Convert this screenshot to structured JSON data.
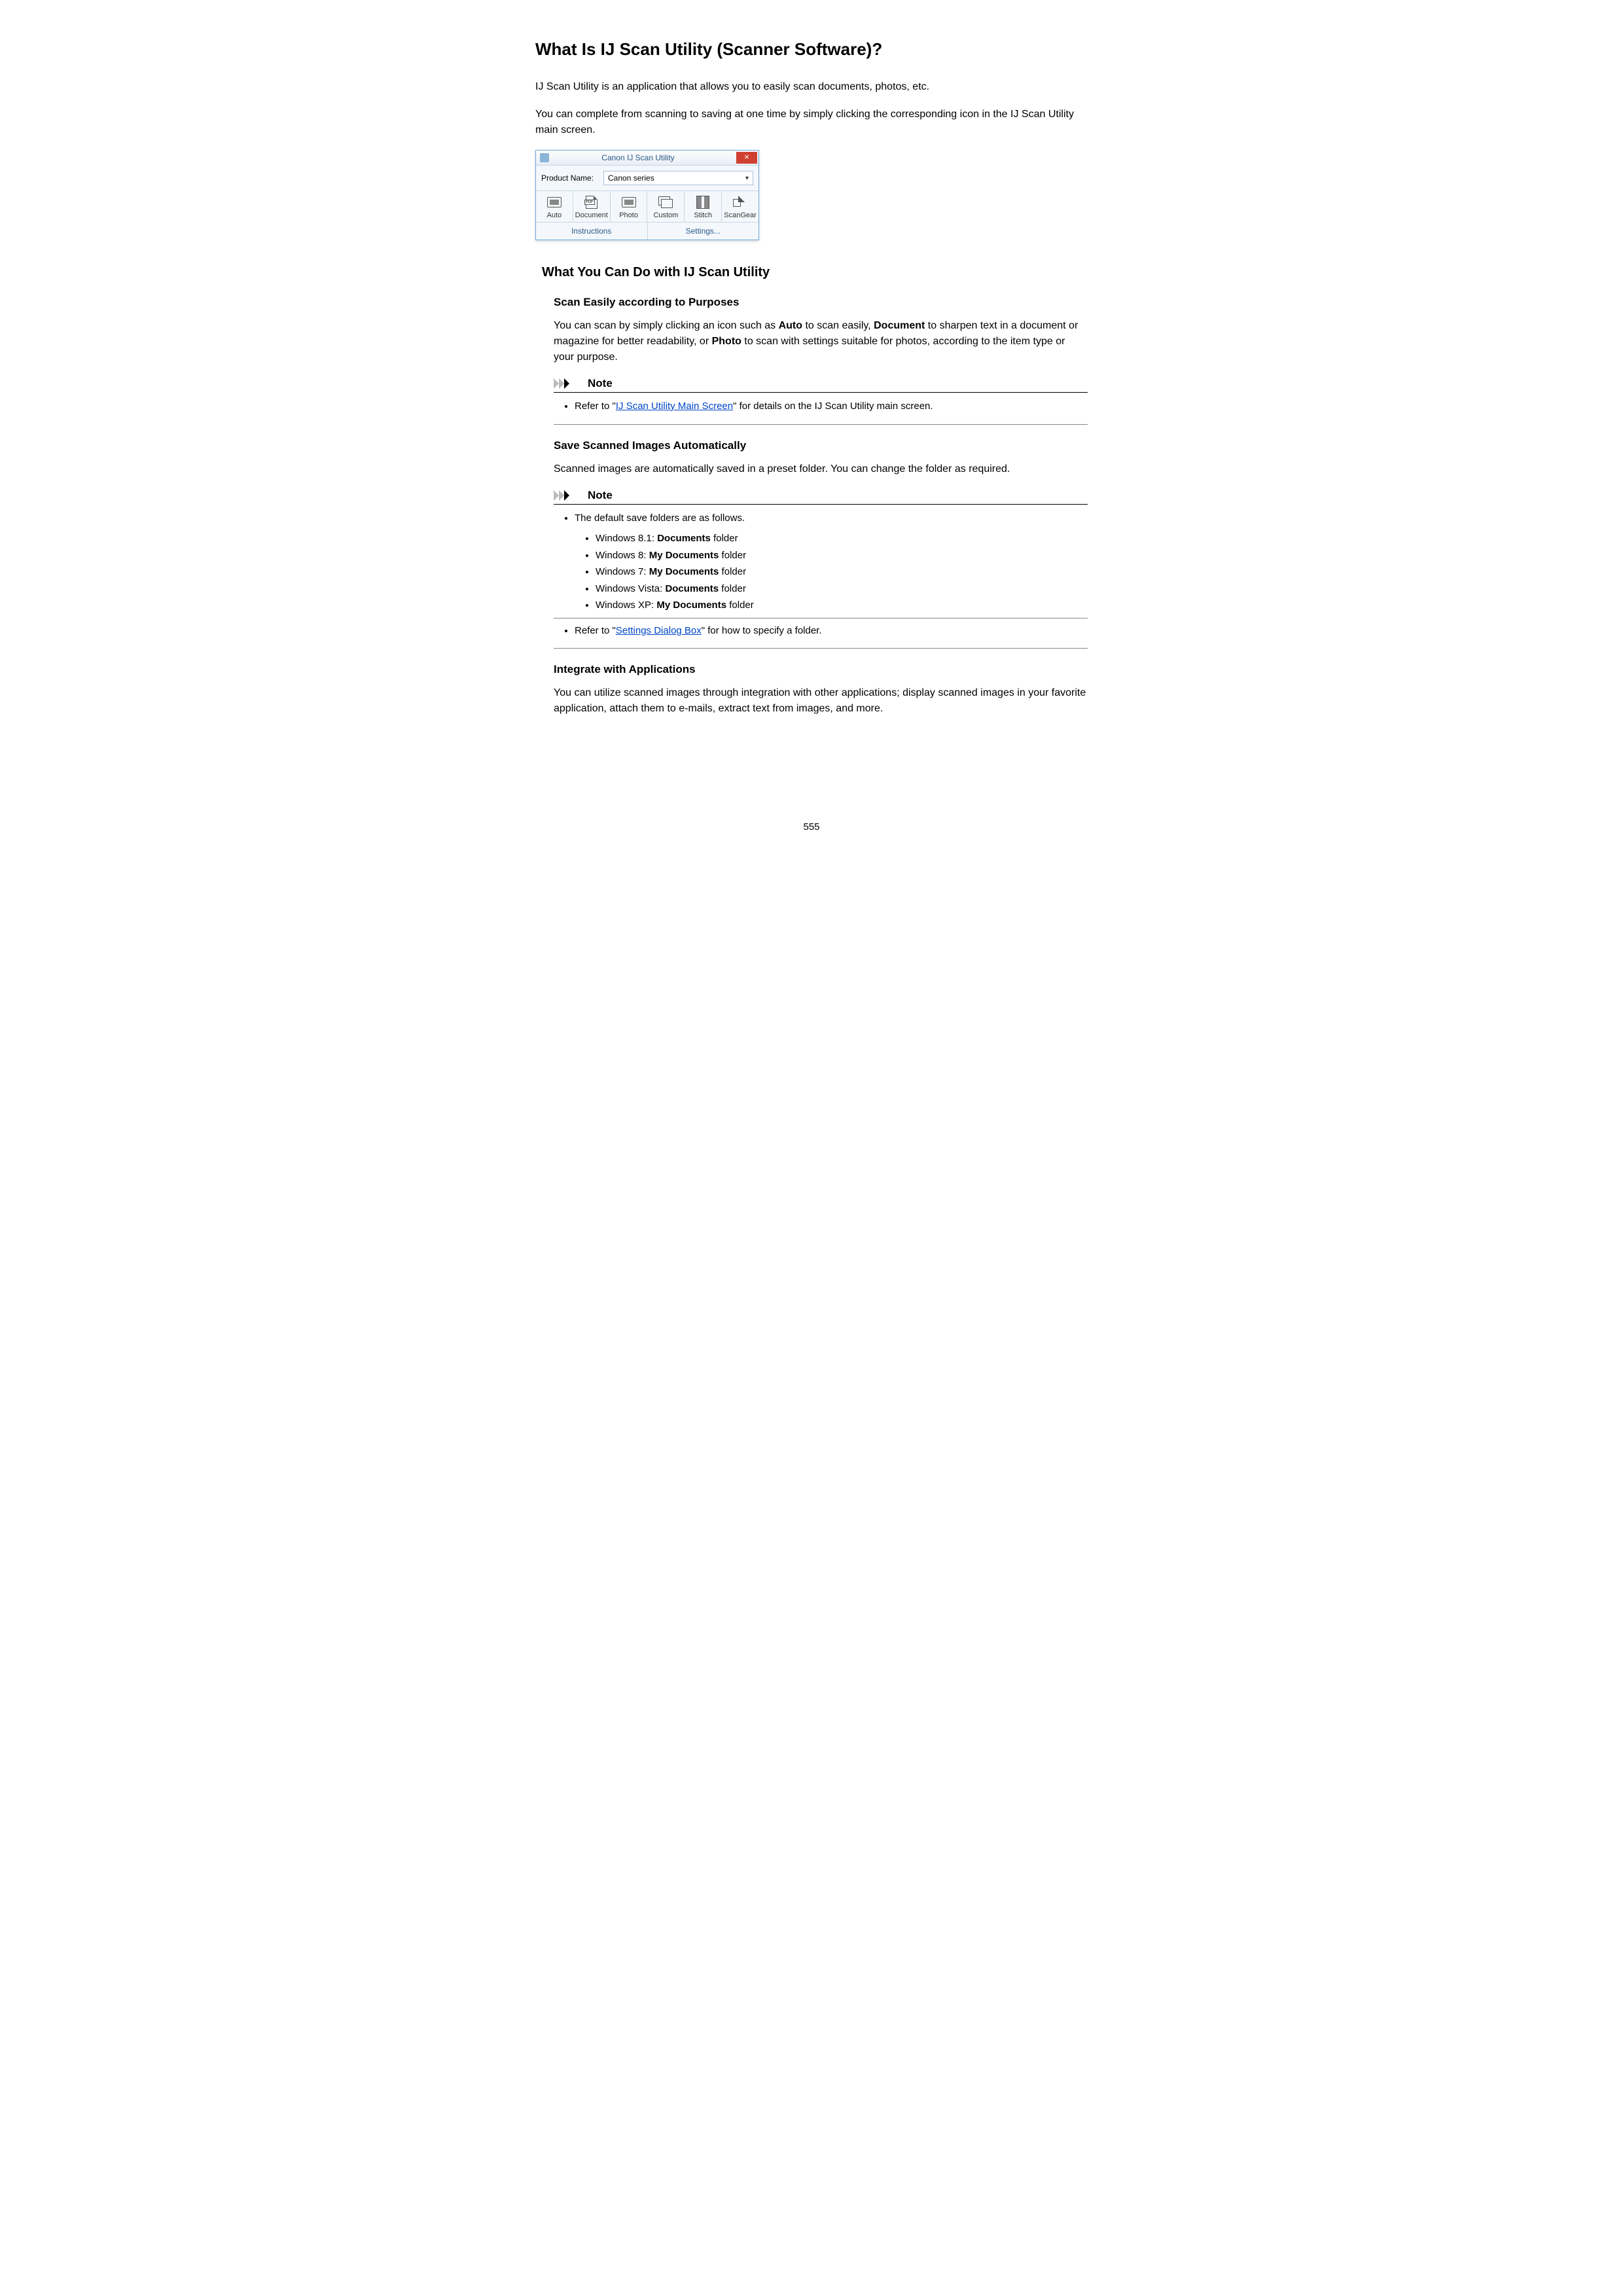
{
  "h1": "What Is IJ Scan Utility (Scanner Software)?",
  "p1": "IJ Scan Utility is an application that allows you to easily scan documents, photos, etc.",
  "p2": "You can complete from scanning to saving at one time by simply clicking the corresponding icon in the IJ Scan Utility main screen.",
  "app": {
    "title": "Canon IJ Scan Utility",
    "product_label": "Product Name:",
    "product_value": "Canon           series",
    "buttons": {
      "auto": "Auto",
      "document": "Document",
      "photo": "Photo",
      "custom": "Custom",
      "stitch": "Stitch",
      "scangear": "ScanGear"
    },
    "instructions": "Instructions",
    "settings": "Settings..."
  },
  "h2": "What You Can Do with IJ Scan Utility",
  "sec1": {
    "h3": "Scan Easily according to Purposes",
    "p_a": "You can scan by simply clicking an icon such as ",
    "b1": "Auto",
    "p_b": " to scan easily, ",
    "b2": "Document",
    "p_c": " to sharpen text in a document or magazine for better readability, or ",
    "b3": "Photo",
    "p_d": " to scan with settings suitable for photos, according to the item type or your purpose.",
    "note_title": "Note",
    "note_pre": "Refer to \"",
    "note_link": "IJ Scan Utility Main Screen",
    "note_post": "\" for details on the IJ Scan Utility main screen."
  },
  "sec2": {
    "h3": "Save Scanned Images Automatically",
    "p": "Scanned images are automatically saved in a preset folder. You can change the folder as required.",
    "note_title": "Note",
    "intro": "The default save folders are as follows.",
    "items": [
      {
        "pre": "Windows 8.1: ",
        "b": "Documents",
        "post": " folder"
      },
      {
        "pre": "Windows 8: ",
        "b": "My Documents",
        "post": " folder"
      },
      {
        "pre": "Windows 7: ",
        "b": "My Documents",
        "post": " folder"
      },
      {
        "pre": "Windows Vista: ",
        "b": "Documents",
        "post": " folder"
      },
      {
        "pre": "Windows XP: ",
        "b": "My Documents",
        "post": " folder"
      }
    ],
    "ref_pre": "Refer to \"",
    "ref_link": "Settings Dialog Box",
    "ref_post": "\" for how to specify a folder."
  },
  "sec3": {
    "h3": "Integrate with Applications",
    "p": "You can utilize scanned images through integration with other applications; display scanned images in your favorite application, attach them to e-mails, extract text from images, and more."
  },
  "page_number": "555"
}
